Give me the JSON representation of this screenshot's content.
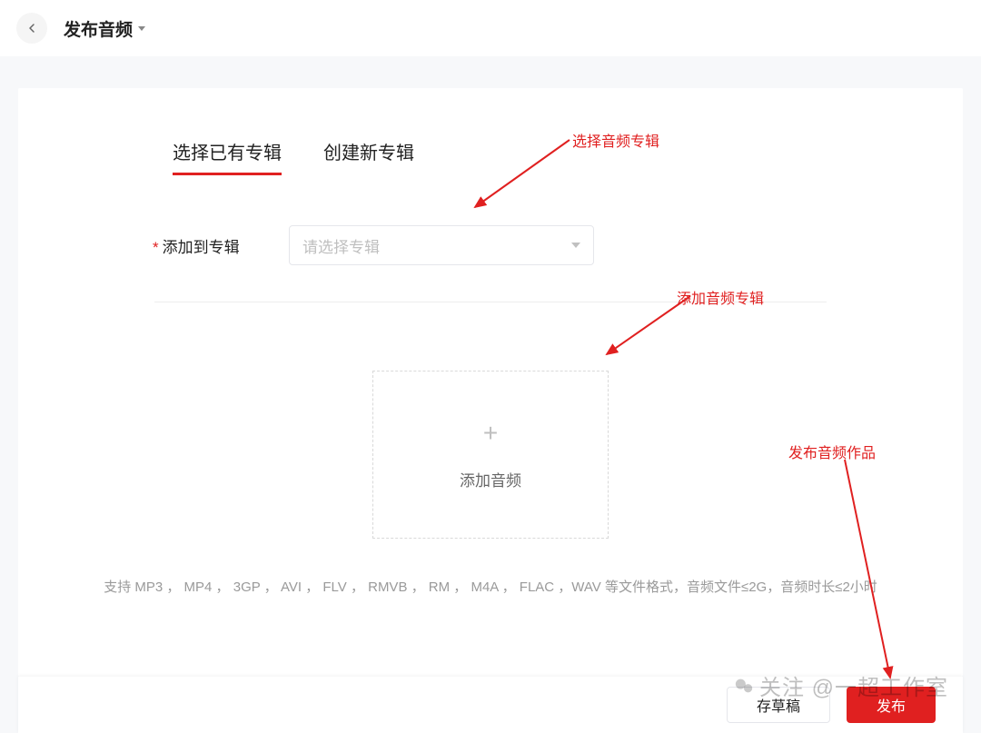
{
  "header": {
    "title": "发布音频"
  },
  "tabs": {
    "existing": "选择已有专辑",
    "create": "创建新专辑"
  },
  "form": {
    "add_to_album_label": "添加到专辑",
    "select_placeholder": "请选择专辑"
  },
  "upload": {
    "label": "添加音频",
    "hint": "支持 MP3 ， MP4 ， 3GP ， AVI ， FLV ， RMVB ， RM ， M4A ， FLAC ，WAV 等文件格式，音频文件≤2G，音频时长≤2小时"
  },
  "footer": {
    "cancel": "存草稿",
    "publish": "发布"
  },
  "annotations": {
    "a1": "选择音频专辑",
    "a2": "添加音频专辑",
    "a3": "发布音频作品"
  },
  "watermark": "关注 @一超工作室"
}
